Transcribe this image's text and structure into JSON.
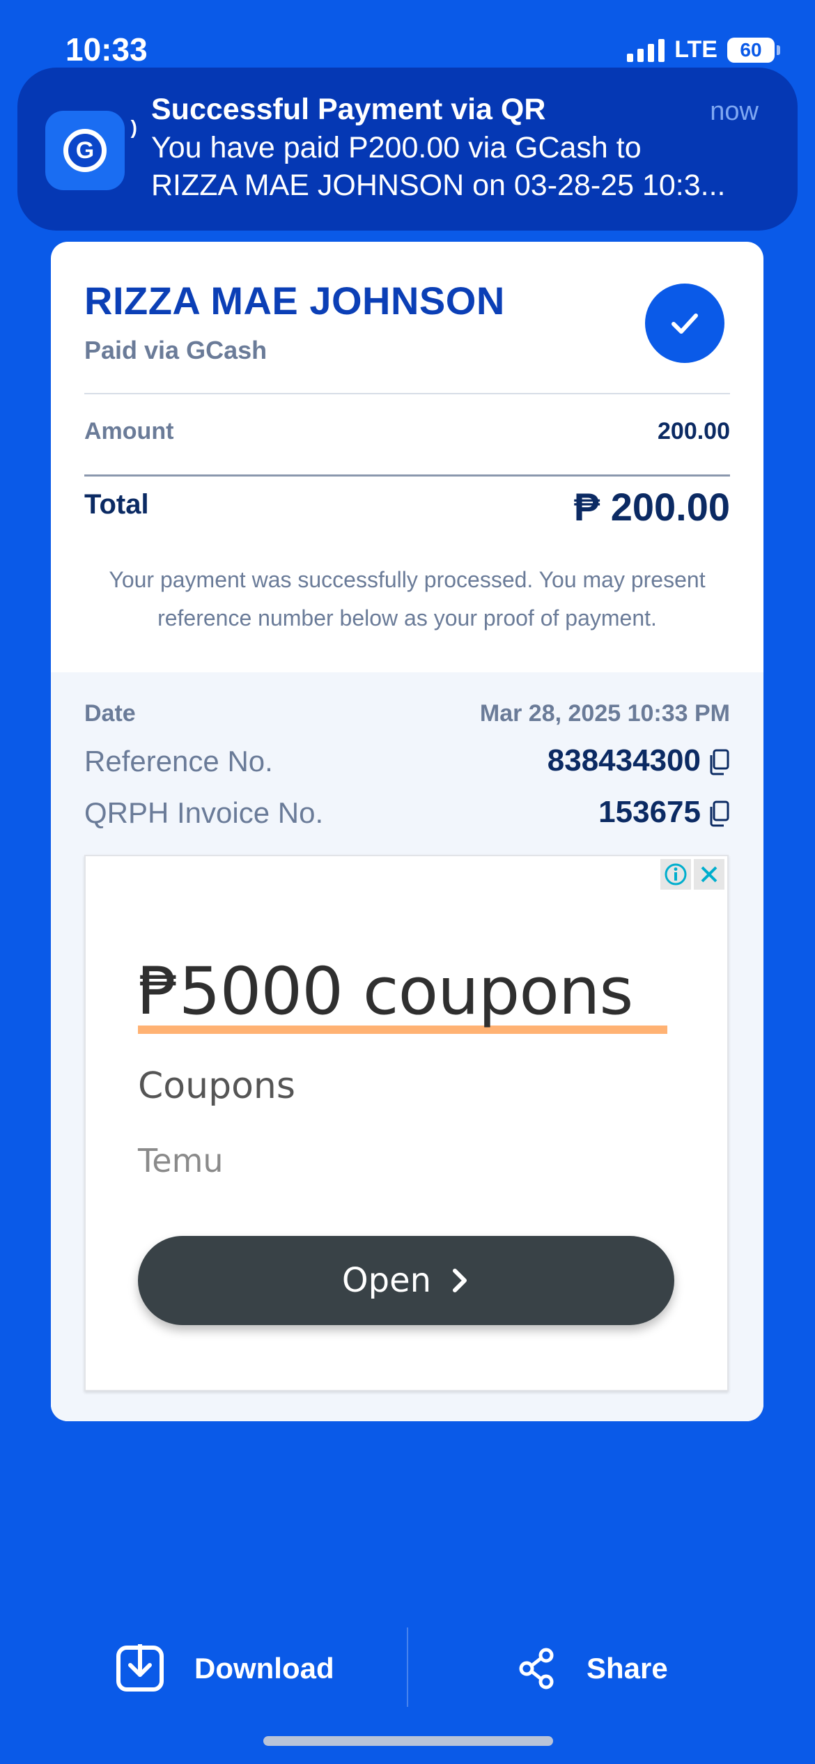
{
  "status_bar": {
    "time": "10:33",
    "network": "LTE",
    "battery": "60"
  },
  "notification": {
    "app_icon": "gcash-logo-icon",
    "title": "Successful Payment via QR",
    "time": "now",
    "body_line1": "You have paid P200.00 via GCash to",
    "body_line2": "RIZZA MAE JOHNSON on 03-28-25 10:3..."
  },
  "receipt": {
    "merchant_name": "RIZZA MAE JOHNSON",
    "paid_via": "Paid via GCash",
    "status_icon": "check-icon",
    "amount_label": "Amount",
    "amount_value": "200.00",
    "total_label": "Total",
    "total_value": "₱ 200.00",
    "note": "Your payment was successfully processed. You may present reference number below as your proof of payment.",
    "date_label": "Date",
    "date_value": "Mar 28, 2025 10:33 PM",
    "reference_label": "Reference No.",
    "reference_value": "838434300",
    "invoice_label": "QRPH Invoice No.",
    "invoice_value": "153675"
  },
  "ad": {
    "headline": "₱5000 coupons",
    "subtitle": "Coupons",
    "brand": "Temu",
    "cta": "Open"
  },
  "actions": {
    "download_label": "Download",
    "share_label": "Share"
  },
  "colors": {
    "background": "#0a5ae8",
    "notification_bg": "#0538b4",
    "brand_blue": "#0b3fb6",
    "text_dark": "#0b2a63",
    "text_muted": "#6a7b98"
  }
}
